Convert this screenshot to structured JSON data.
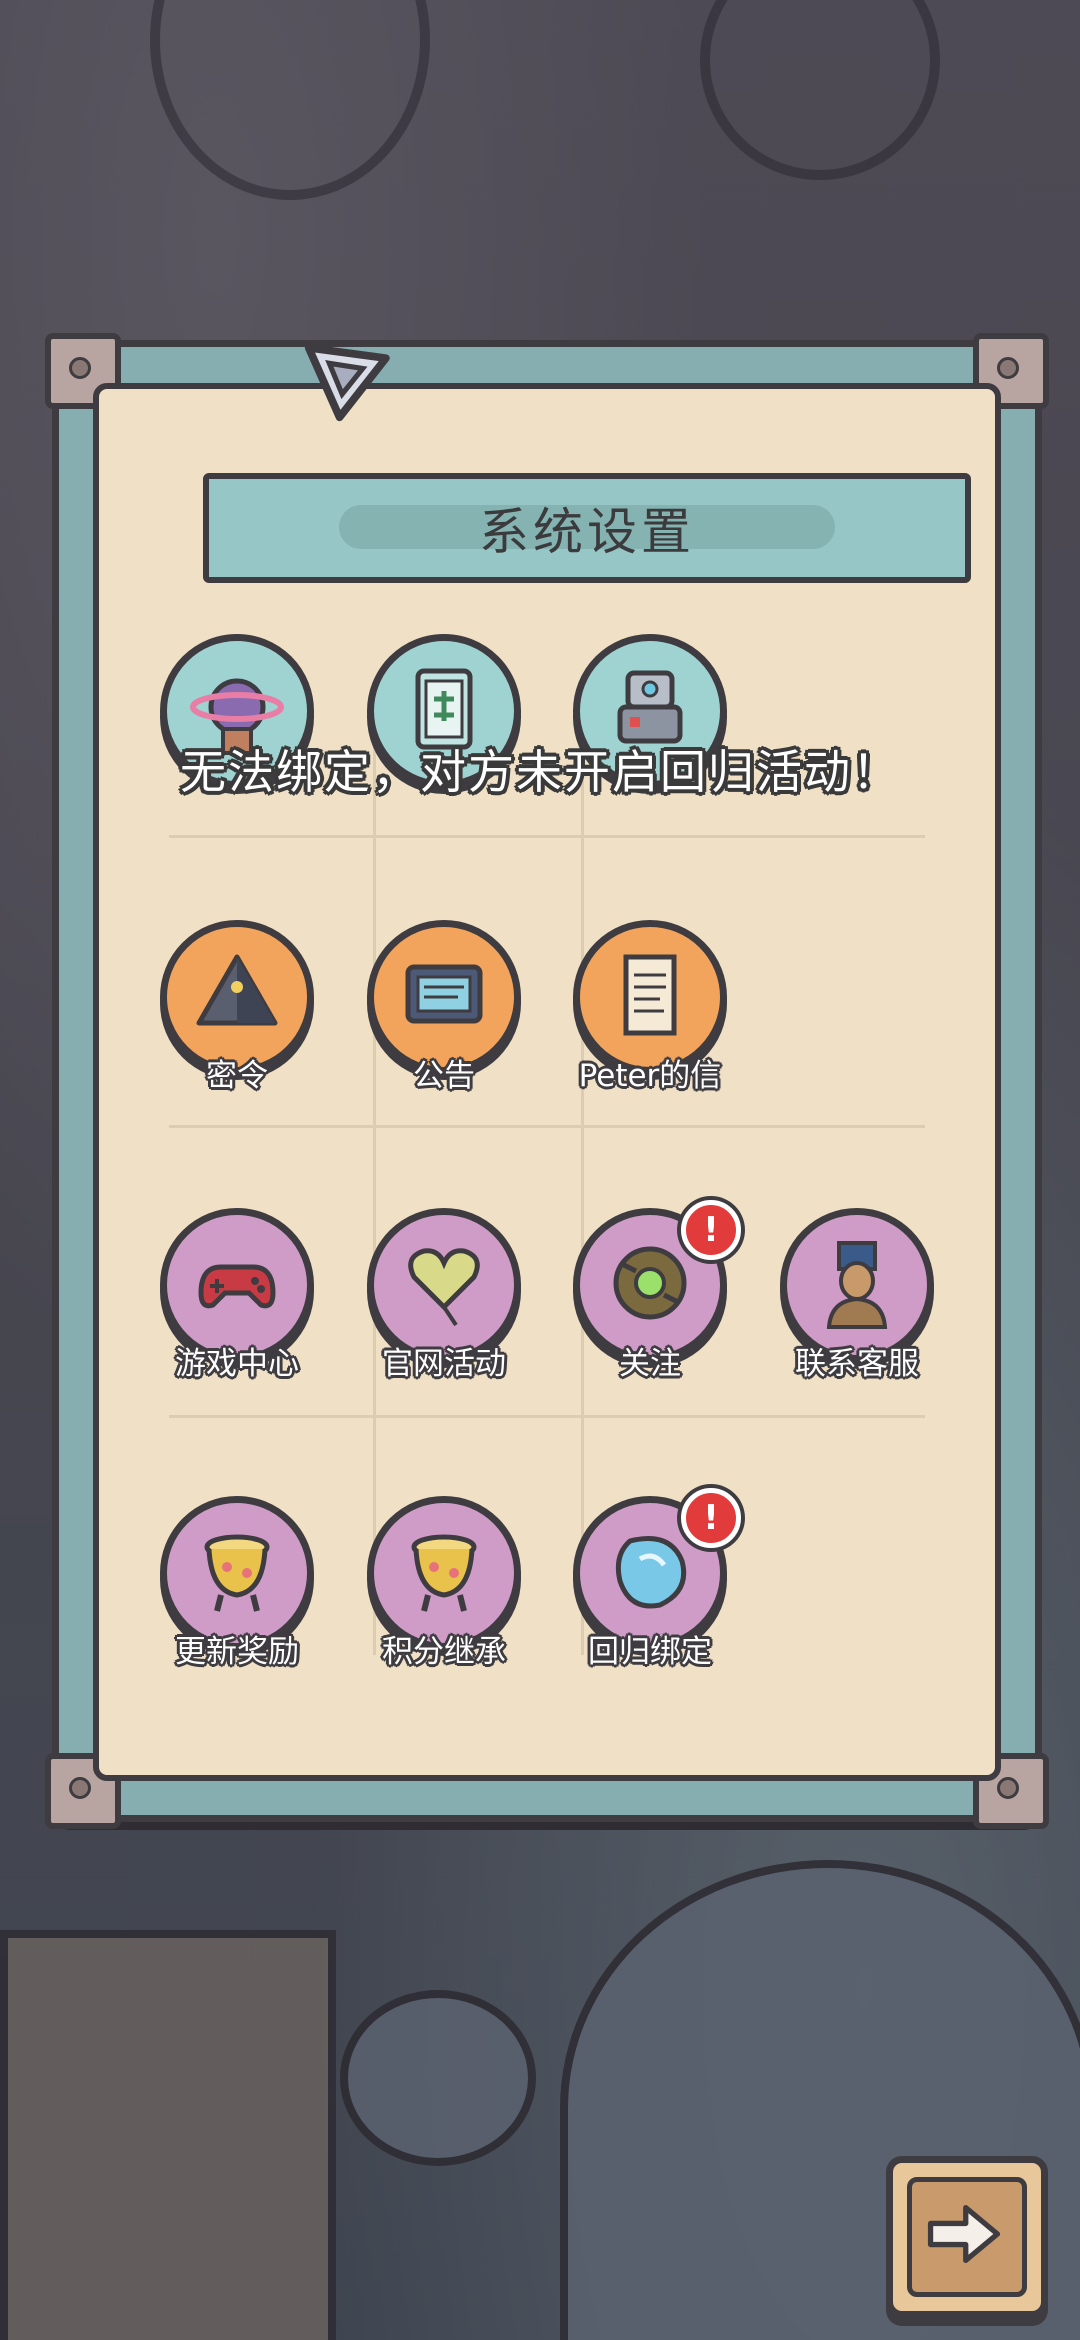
{
  "dialog": {
    "title": "系统设置"
  },
  "toast": {
    "message": "无法绑定，对方未开启回归活动！"
  },
  "buttons": [
    {
      "id": "planet",
      "label": "",
      "icon": "planet-robot-icon",
      "color": "teal",
      "badge": false
    },
    {
      "id": "mahjong",
      "label": "",
      "icon": "mahjong-tile-icon",
      "color": "teal",
      "badge": false
    },
    {
      "id": "robot",
      "label": "",
      "icon": "robot-icon",
      "color": "teal",
      "badge": false
    },
    {
      "id": "code",
      "label": "密令",
      "icon": "pyramid-icon",
      "color": "orange",
      "badge": false
    },
    {
      "id": "notice",
      "label": "公告",
      "icon": "notice-board-icon",
      "color": "orange",
      "badge": false
    },
    {
      "id": "letter",
      "label": "Peter的信",
      "icon": "letter-scroll-icon",
      "color": "orange",
      "badge": false
    },
    {
      "id": "game-center",
      "label": "游戏中心",
      "icon": "gamepad-icon",
      "color": "purple",
      "badge": false
    },
    {
      "id": "official-event",
      "label": "官网活动",
      "icon": "heart-balloon-icon",
      "color": "purple",
      "badge": false
    },
    {
      "id": "follow",
      "label": "关注",
      "icon": "compass-device-icon",
      "color": "purple",
      "badge": true
    },
    {
      "id": "customer-service",
      "label": "联系客服",
      "icon": "pharaoh-bust-icon",
      "color": "purple",
      "badge": false
    },
    {
      "id": "update-reward",
      "label": "更新奖励",
      "icon": "golden-pot-icon",
      "color": "purple",
      "badge": false
    },
    {
      "id": "points-inherit",
      "label": "积分继承",
      "icon": "golden-pot-icon",
      "color": "purple",
      "badge": false
    },
    {
      "id": "return-bind",
      "label": "回归绑定",
      "icon": "crystal-icon",
      "color": "purple",
      "badge": true
    }
  ],
  "badge_symbol": "!",
  "next_button": {
    "icon": "arrow-right-icon"
  },
  "colors": {
    "panel_frame": "#86aeb0",
    "panel_paper": "#f0e1c6",
    "title_bar": "#96c6c5",
    "teal": "#9fd3d2",
    "orange": "#f2a45c",
    "purple": "#cf9cc8",
    "badge": "#e23b3b"
  }
}
